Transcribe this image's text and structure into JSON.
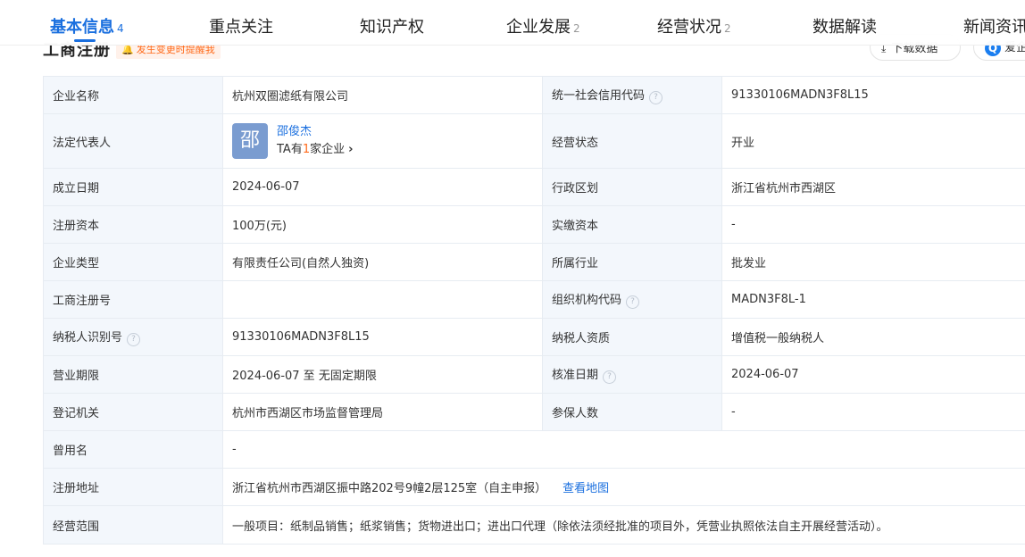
{
  "tabs": [
    {
      "label": "基本信息",
      "count": "4",
      "active": true
    },
    {
      "label": "重点关注",
      "count": ""
    },
    {
      "label": "知识产权",
      "count": ""
    },
    {
      "label": "企业发展",
      "count": "2"
    },
    {
      "label": "经营状况",
      "count": "2"
    },
    {
      "label": "数据解读",
      "count": ""
    },
    {
      "label": "新闻资讯",
      "count": ""
    }
  ],
  "section": {
    "title": "工商注册",
    "update_notice": "发生变更时提醒我",
    "download_label": "下载数据",
    "report_label": "爱企查"
  },
  "rows": {
    "company_name": {
      "label": "企业名称",
      "value": "杭州双圈滤纸有限公司"
    },
    "credit_code": {
      "label": "统一社会信用代码",
      "value": "91330106MADN3F8L15"
    },
    "legal_rep": {
      "label": "法定代表人",
      "avatar_char": "邵",
      "name": "邵俊杰",
      "sub_prefix": "TA有",
      "sub_count": "1",
      "sub_suffix": "家企业"
    },
    "status": {
      "label": "经营状态",
      "value": "开业"
    },
    "founded": {
      "label": "成立日期",
      "value": "2024-06-07"
    },
    "region": {
      "label": "行政区划",
      "value": "浙江省杭州市西湖区"
    },
    "reg_capital": {
      "label": "注册资本",
      "value": "100万(元)"
    },
    "paid_capital": {
      "label": "实缴资本",
      "value": "-"
    },
    "company_type": {
      "label": "企业类型",
      "value": "有限责任公司(自然人独资)"
    },
    "industry": {
      "label": "所属行业",
      "value": "批发业"
    },
    "reg_number": {
      "label": "工商注册号",
      "value": ""
    },
    "org_code": {
      "label": "组织机构代码",
      "value": "MADN3F8L-1"
    },
    "taxpayer_id": {
      "label": "纳税人识别号",
      "value": "91330106MADN3F8L15"
    },
    "taxpayer_qual": {
      "label": "纳税人资质",
      "value": "增值税一般纳税人"
    },
    "business_term": {
      "label": "营业期限",
      "value": "2024-06-07 至 无固定期限"
    },
    "approval_date": {
      "label": "核准日期",
      "value": "2024-06-07"
    },
    "authority": {
      "label": "登记机关",
      "value": "杭州市西湖区市场监督管理局"
    },
    "insured": {
      "label": "参保人数",
      "value": "-"
    },
    "former_name": {
      "label": "曾用名",
      "value": "-"
    },
    "address": {
      "label": "注册地址",
      "value": "浙江省杭州市西湖区振中路202号9幢2层125室（自主申报）",
      "map_link": "查看地图"
    },
    "scope": {
      "label": "经营范围",
      "value": "一般项目：纸制品销售；纸浆销售；货物进出口；进出口代理（除依法须经批准的项目外，凭营业执照依法自主开展经营活动）。"
    }
  },
  "colors": {
    "accent": "#1a6fdf",
    "label_bg": "#f3f7fc",
    "warning": "#ff6a1a"
  }
}
